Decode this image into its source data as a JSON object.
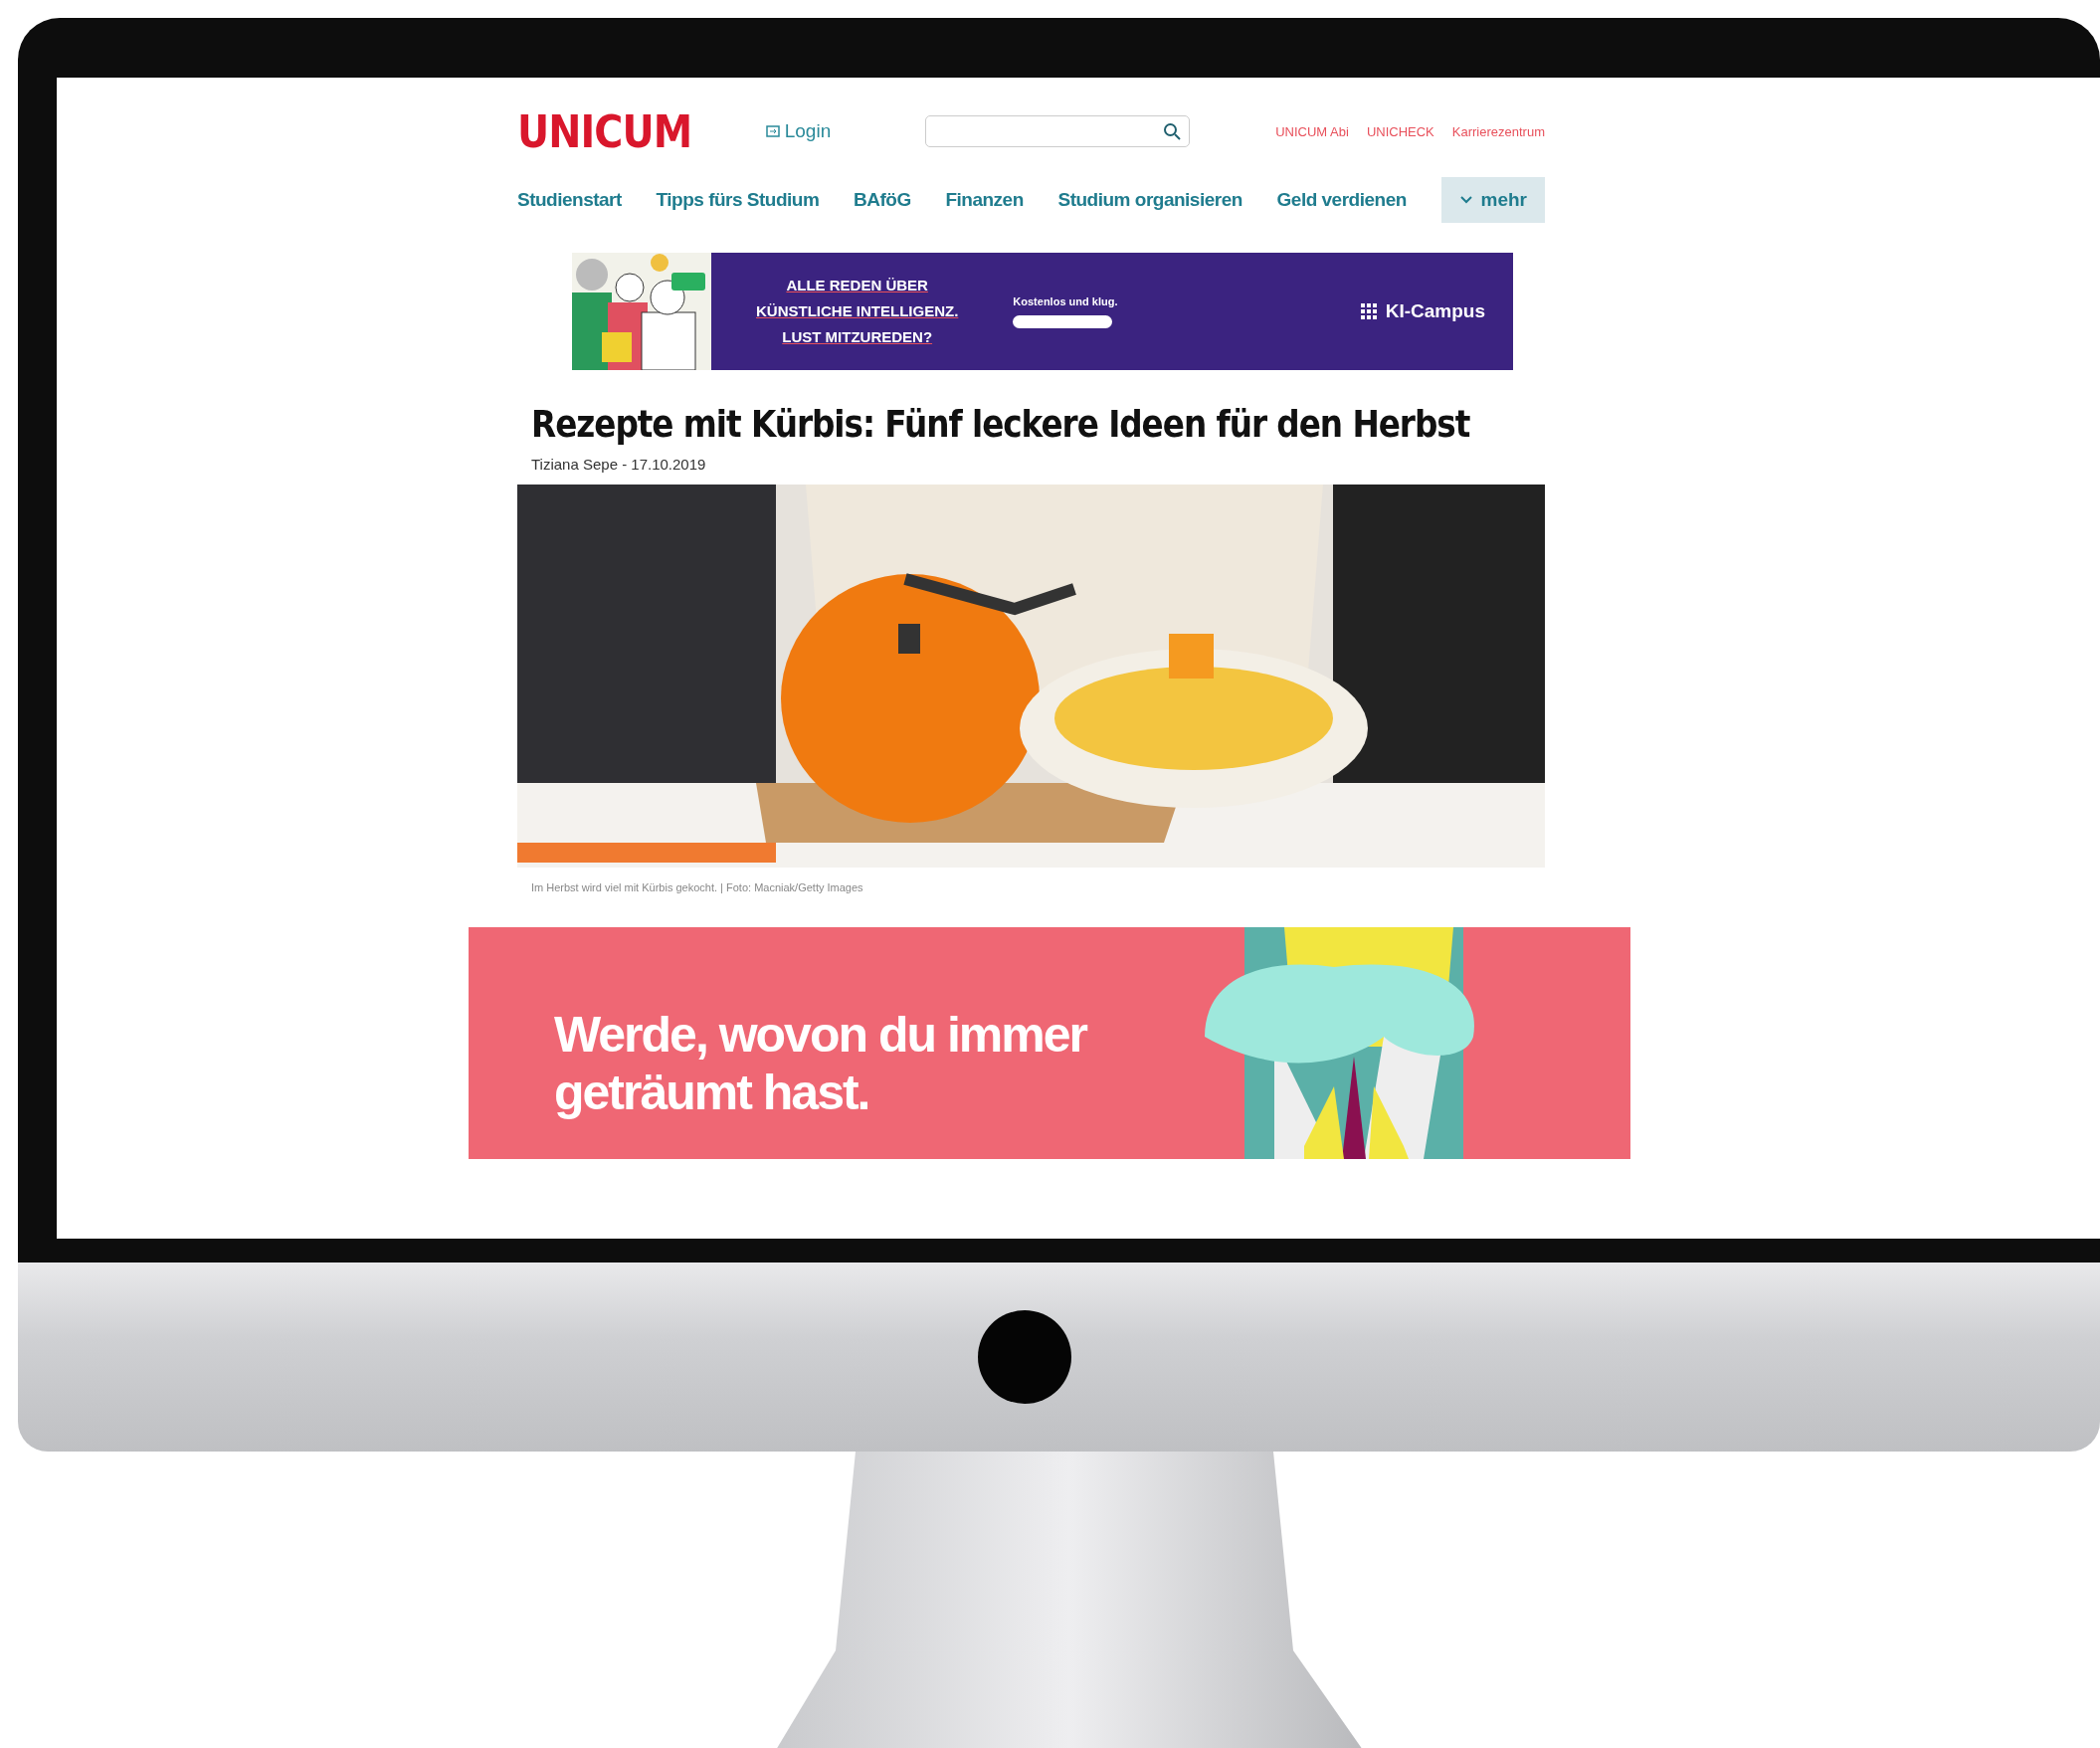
{
  "header": {
    "logo": "UNICUM",
    "login": "Login",
    "links": [
      "UNICUM Abi",
      "UNICHECK",
      "Karrierezentrum"
    ]
  },
  "nav": {
    "items": [
      "Studienstart",
      "Tipps fürs Studium",
      "BAföG",
      "Finanzen",
      "Studium organisieren",
      "Geld verdienen"
    ],
    "more": "mehr"
  },
  "ad_banner": {
    "headline": [
      "ALLE REDEN ÜBER",
      "KÜNSTLICHE INTELLIGENZ.",
      "LUST MITZUREDEN?"
    ],
    "tagline": "Kostenlos und klug.",
    "brand": "KI-Campus"
  },
  "article": {
    "title": "Rezepte mit Kürbis: Fünf leckere Ideen für den Herbst",
    "byline": "Tiziana Sepe - 17.10.2019",
    "caption": "Im Herbst wird viel mit Kürbis gekocht. | Foto: Macniak/Getty Images"
  },
  "promo_banner": {
    "text": [
      "Werde, wovon du immer",
      "geträumt hast."
    ]
  }
}
